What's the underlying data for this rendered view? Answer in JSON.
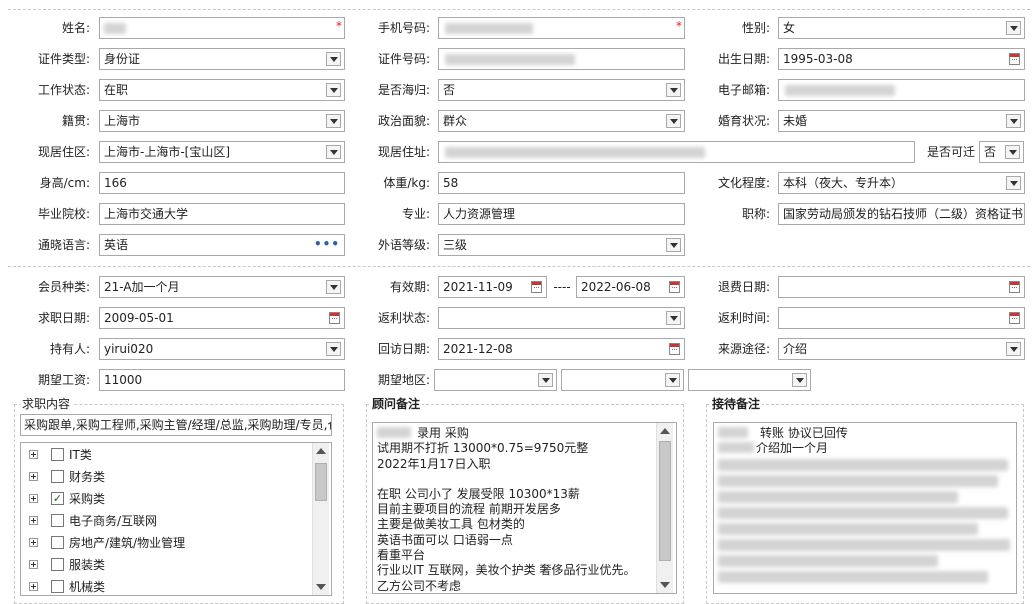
{
  "form": {
    "name_label": "姓名:",
    "mobile_label": "手机号码:",
    "gender_label": "性别:",
    "gender_value": "女",
    "id_type_label": "证件类型:",
    "id_type_value": "身份证",
    "id_no_label": "证件号码:",
    "birth_label": "出生日期:",
    "birth_value": "1995-03-08",
    "work_status_label": "工作状态:",
    "work_status_value": "在职",
    "overseas_label": "是否海归:",
    "overseas_value": "否",
    "email_label": "电子邮箱:",
    "native_label": "籍贯:",
    "native_value": "上海市",
    "political_label": "政治面貌:",
    "political_value": "群众",
    "marital_label": "婚育状况:",
    "marital_value": "未婚",
    "residence_area_label": "现居住区:",
    "residence_area_value": "上海市-上海市-[宝山区]",
    "residence_addr_label": "现居住址:",
    "relocate_label": "是否可迁",
    "relocate_value": "否",
    "height_label": "身高/cm:",
    "height_value": "166",
    "weight_label": "体重/kg:",
    "weight_value": "58",
    "education_label": "文化程度:",
    "education_value": "本科（夜大、专升本）",
    "school_label": "毕业院校:",
    "school_value": "上海市交通大学",
    "major_label": "专业:",
    "major_value": "人力资源管理",
    "title_label": "职称:",
    "title_value": "国家劳动局颁发的钻石技师（二级）资格证书",
    "language_label": "通晓语言:",
    "language_value": "英语",
    "language_more": "•••",
    "lang_level_label": "外语等级:",
    "lang_level_value": "三级"
  },
  "member": {
    "type_label": "会员种类:",
    "type_value": "21-A加一个月",
    "valid_label": "有效期:",
    "valid_from": "2021-11-09",
    "valid_sep": "----",
    "valid_to": "2022-06-08",
    "refund_date_label": "退费日期:",
    "job_date_label": "求职日期:",
    "job_date_value": "2009-05-01",
    "rebate_status_label": "返利状态:",
    "rebate_time_label": "返利时间:",
    "holder_label": "持有人:",
    "holder_value": "yirui020",
    "visit_date_label": "回访日期:",
    "visit_date_value": "2021-12-08",
    "source_label": "来源途径:",
    "source_value": "介绍",
    "salary_label": "期望工资:",
    "salary_value": "11000",
    "region_label": "期望地区:"
  },
  "job_content": {
    "title": "求职内容",
    "summary": "采购跟单,采购工程师,采购主管/经理/总监,采购助理/专员,仓",
    "categories": [
      {
        "label": "IT类",
        "checked": false
      },
      {
        "label": "财务类",
        "checked": false
      },
      {
        "label": "采购类",
        "checked": true
      },
      {
        "label": "电子商务/互联网",
        "checked": false
      },
      {
        "label": "房地产/建筑/物业管理",
        "checked": false
      },
      {
        "label": "服装类",
        "checked": false
      },
      {
        "label": "机械类",
        "checked": false
      }
    ]
  },
  "consultant_notes": {
    "title": "顾问备注",
    "lines": [
      "录用 采购",
      "试用期不打折 13000*0.75=9750元整",
      "2022年1月17日入职",
      "",
      "在职 公司小了 发展受限   10300*13薪",
      "目前主要项目的流程 前期开发居多",
      "主要是做美妆工具 包材类的",
      "英语书面可以  口语弱一点",
      "看重平台",
      "行业以IT 互联网，美妆个护类 奢侈品行业优先。",
      "乙方公司不考虑"
    ]
  },
  "reception_notes": {
    "title": "接待备注",
    "line1": "转账    协议已回传",
    "line2": "介绍加一个月"
  },
  "colors": {
    "required_star": "#e02020",
    "border": "#a9a9a9",
    "check_green": "#1a6b1a"
  }
}
